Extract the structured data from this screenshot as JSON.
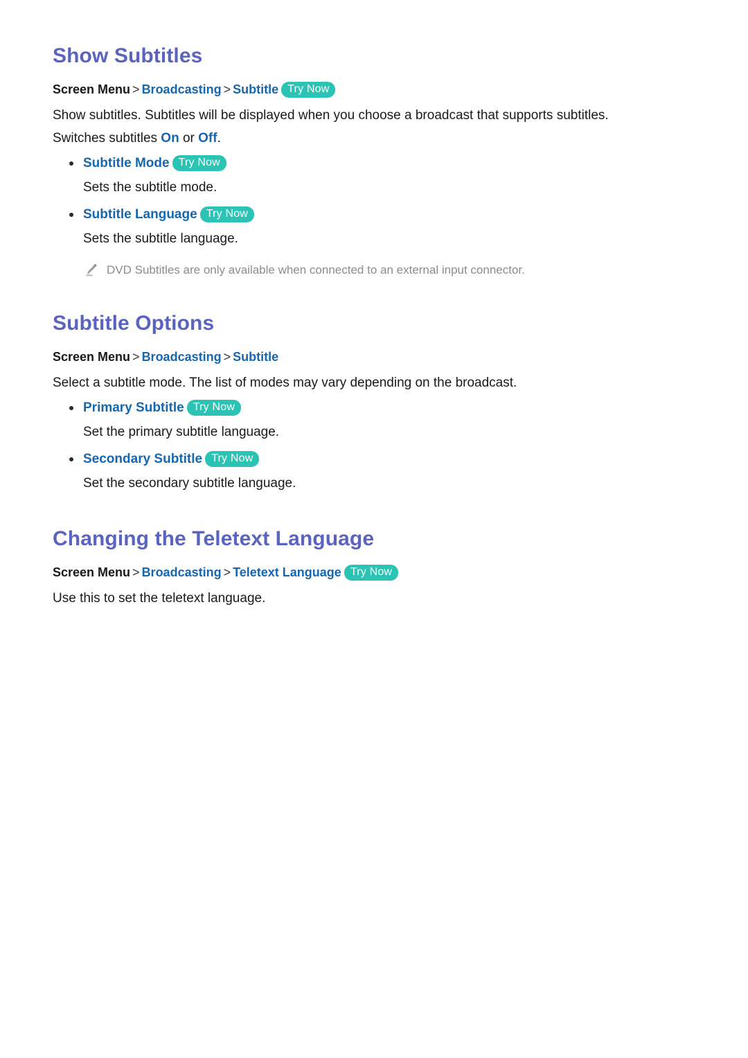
{
  "page": {
    "background_color": "#ffffff",
    "accent_heading_color": "#5a63c0",
    "link_color": "#1567b0",
    "badge_color": "#2bc4b4",
    "note_color": "#8c8c8c",
    "body_color": "#1a1a1a"
  },
  "badge": {
    "try_now_label": "Try Now"
  },
  "separator": ">",
  "sections": [
    {
      "heading": "Show Subtitles",
      "breadcrumb": {
        "root": "Screen Menu",
        "items": [
          "Broadcasting",
          "Subtitle"
        ],
        "has_badge": true
      },
      "paragraphs": [
        "Show subtitles. Subtitles will be displayed when you choose a broadcast that supports subtitles.",
        "Switches subtitles On or Off."
      ],
      "paragraph2": {
        "lead": "Switches subtitles ",
        "link1": "On",
        "middle": " or ",
        "link2": "Off",
        "tail": "."
      },
      "bullets": [
        {
          "label": "Subtitle Mode",
          "has_badge": true,
          "description": "Sets the subtitle mode."
        },
        {
          "label": "Subtitle Language",
          "has_badge": true,
          "description": "Sets the subtitle language."
        }
      ],
      "note": {
        "icon": "pencil-icon",
        "text": "DVD Subtitles are only available when connected to an external input connector."
      }
    },
    {
      "heading": "Subtitle Options",
      "breadcrumb": {
        "root": "Screen Menu",
        "items": [
          "Broadcasting",
          "Subtitle"
        ],
        "has_badge": false
      },
      "paragraphs": [
        "Select a subtitle mode. The list of modes may vary depending on the broadcast."
      ],
      "bullets": [
        {
          "label": "Primary Subtitle",
          "has_badge": true,
          "description": "Set the primary subtitle language."
        },
        {
          "label": "Secondary Subtitle",
          "has_badge": true,
          "description": "Set the secondary subtitle language."
        }
      ]
    },
    {
      "heading": "Changing the Teletext Language",
      "breadcrumb": {
        "root": "Screen Menu",
        "items": [
          "Broadcasting",
          "Teletext Language"
        ],
        "has_badge": true
      },
      "paragraphs": [
        "Use this to set the teletext language."
      ]
    }
  ]
}
